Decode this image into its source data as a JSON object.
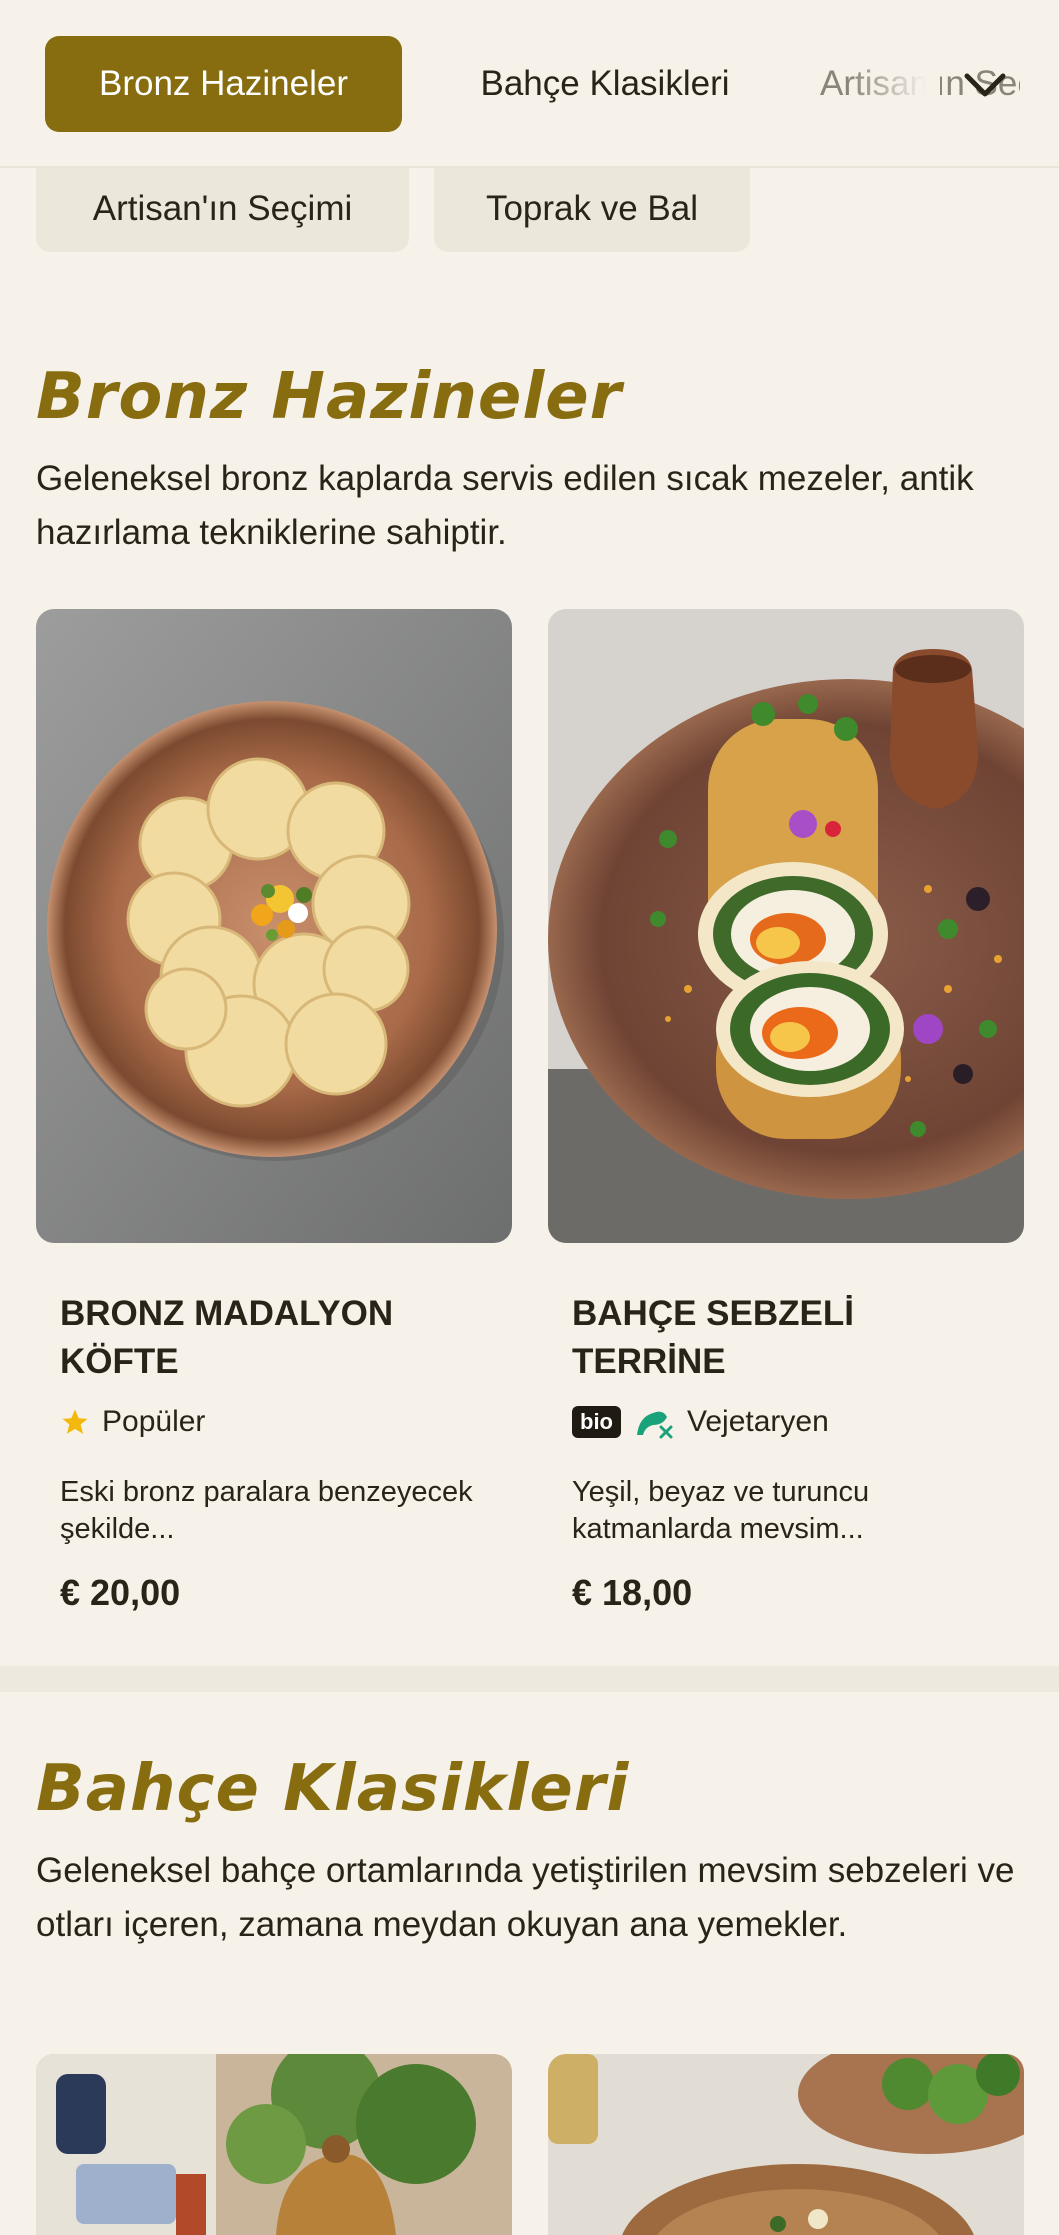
{
  "tabs": [
    {
      "label": "Bronz Hazineler",
      "active": true
    },
    {
      "label": "Bahçe Klasikleri",
      "active": false
    },
    {
      "label": "Artisan'ın Seçimi",
      "active": false
    }
  ],
  "chips": [
    "Artisan'ın Seçimi",
    "Toprak ve Bal"
  ],
  "sections": [
    {
      "title": "Bronz Hazineler",
      "description": "Geleneksel bronz kaplarda servis edilen sıcak mezeler, antik hazırlama tekniklerine sahiptir.",
      "items": [
        {
          "name": "BRONZ MADALYON KÖFTE",
          "tag": "Popüler",
          "tag_icon": "star-icon",
          "description": "Eski bronz paralara benzeyecek şekilde...",
          "price": "€ 20,00"
        },
        {
          "name": "BAHÇE SEBZELİ TERRİNE",
          "badge": "bio",
          "tag": "Vejetaryen",
          "tag_icon": "vegetarian-icon",
          "description": "Yeşil, beyaz ve turuncu katmanlarda mevsim...",
          "price": "€ 18,00"
        }
      ]
    },
    {
      "title": "Bahçe Klasikleri",
      "description": "Geleneksel bahçe ortamlarında yetiştirilen mevsim sebzeleri ve otları içeren, zamana meydan okuyan ana yemekler."
    }
  ],
  "colors": {
    "accent": "#876d10",
    "background": "#f6f2ea",
    "chip": "#ece7db",
    "star": "#f2b90c",
    "vegetarian": "#1aa37a"
  }
}
